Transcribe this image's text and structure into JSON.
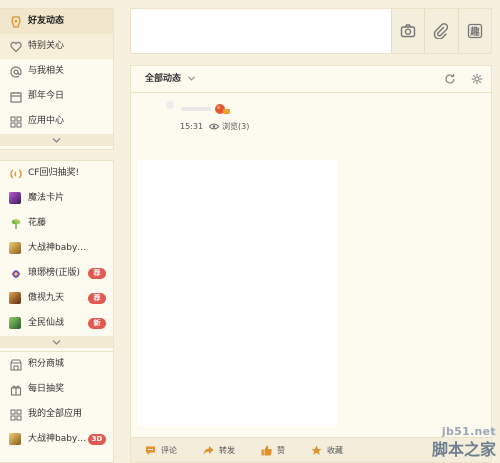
{
  "sidebar": {
    "primary": [
      {
        "label": "好友动态",
        "icon": "friends-feed-icon",
        "active": true
      },
      {
        "label": "特别关心",
        "icon": "heart-icon"
      },
      {
        "label": "与我相关",
        "icon": "at-icon"
      },
      {
        "label": "那年今日",
        "icon": "calendar-icon"
      },
      {
        "label": "应用中心",
        "icon": "apps-grid-icon"
      }
    ],
    "games": [
      {
        "label": "CF回归抽奖!",
        "icon": "cf-game-icon",
        "color": "#e08a2e"
      },
      {
        "label": "魔法卡片",
        "icon": "magic-card-icon",
        "color": "#7a3fa0"
      },
      {
        "label": "花藤",
        "icon": "flower-vine-icon",
        "color": "#5ba33a"
      },
      {
        "label": "大战神baby…",
        "icon": "war-god-icon",
        "color": "#c8a23a"
      },
      {
        "label": "琅琊榜(正版)",
        "icon": "langya-icon",
        "color": "#7a4aa8",
        "badge": "荐"
      },
      {
        "label": "傲视九天",
        "icon": "aoshi-icon",
        "color": "#b46a28",
        "badge": "荐"
      },
      {
        "label": "全民仙战",
        "icon": "xianzhan-icon",
        "color": "#4a8a3a",
        "badge": "新"
      }
    ],
    "bottom": [
      {
        "label": "积分商城",
        "icon": "store-icon"
      },
      {
        "label": "每日抽奖",
        "icon": "gift-icon"
      },
      {
        "label": "我的全部应用",
        "icon": "apps-grid-icon"
      },
      {
        "label": "大战神baby…",
        "icon": "war-god-icon",
        "color": "#c8a23a",
        "badge": "3D"
      }
    ]
  },
  "composer": {
    "tools": [
      "camera-icon",
      "attachment-icon",
      "fun-icon"
    ],
    "fun_label": "趣"
  },
  "feed": {
    "filter_label": "全部动态",
    "post": {
      "time": "15:31",
      "views": "浏览(3)"
    },
    "actions": [
      {
        "label": "评论",
        "icon": "comment-icon"
      },
      {
        "label": "转发",
        "icon": "share-icon"
      },
      {
        "label": "赞",
        "icon": "like-icon"
      },
      {
        "label": "收藏",
        "icon": "star-icon"
      }
    ]
  },
  "watermark": {
    "site": "jb51.net",
    "name": "脚本之家"
  },
  "colors": {
    "accent": "#e0902c",
    "badge": "#e05a52",
    "background": "#f6f0df"
  }
}
